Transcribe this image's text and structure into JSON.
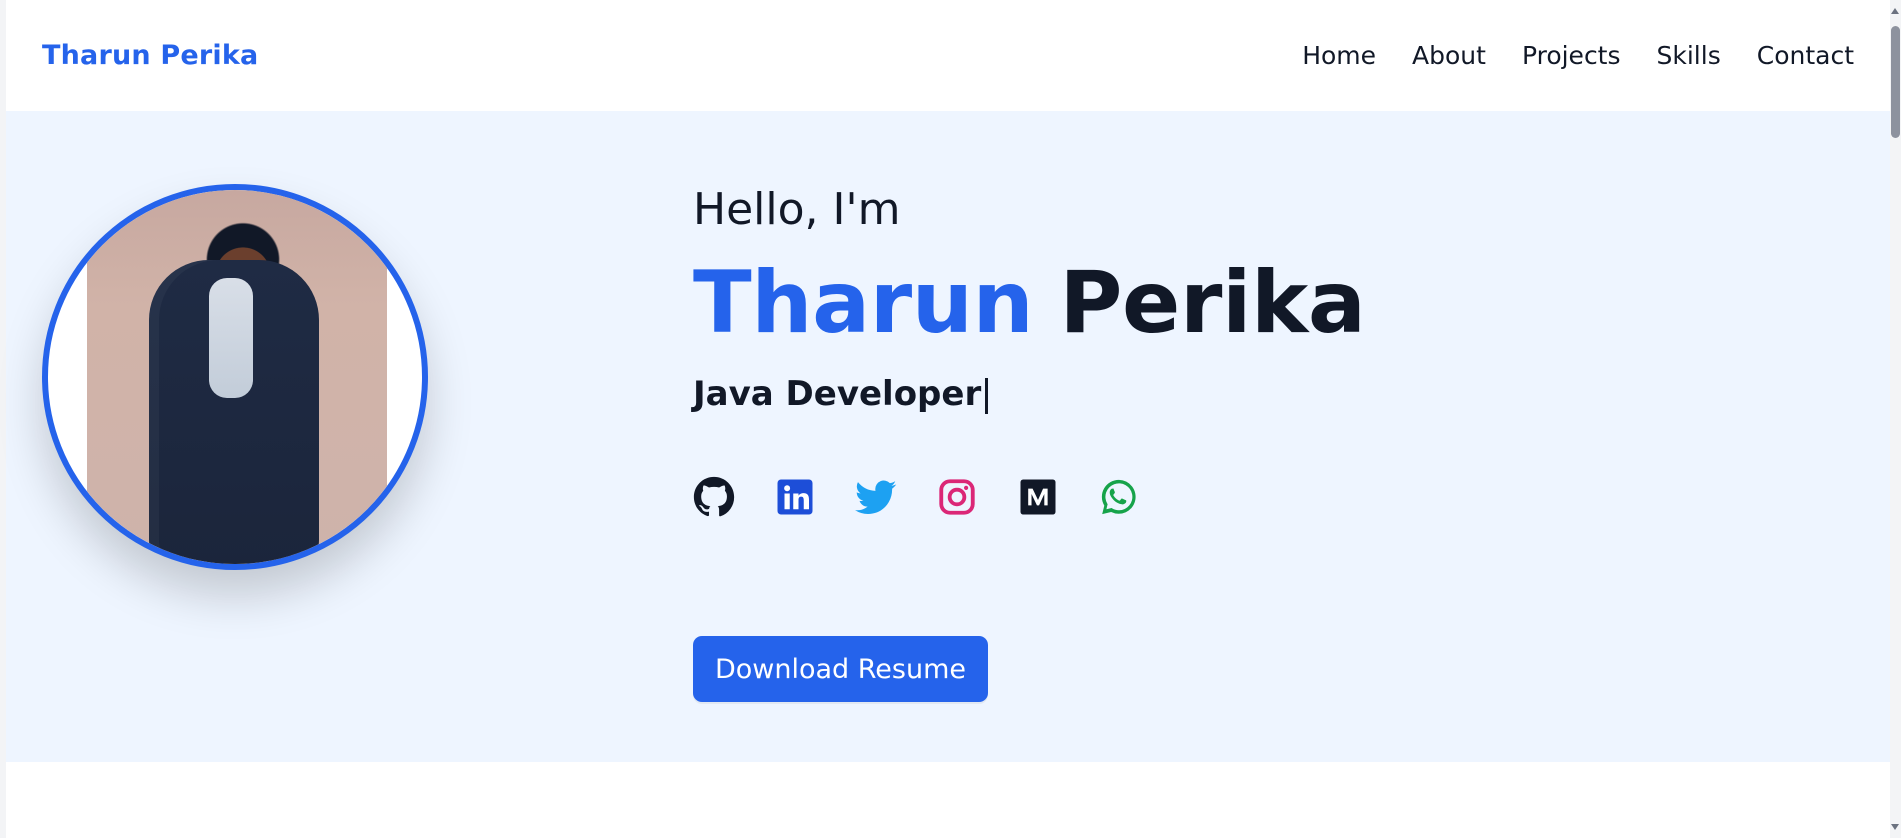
{
  "header": {
    "brand": "Tharun Perika",
    "nav": [
      "Home",
      "About",
      "Projects",
      "Skills",
      "Contact"
    ]
  },
  "hero": {
    "greeting": "Hello, I'm",
    "name_first": "Tharun",
    "name_last": "Perika",
    "role": "Java Developer",
    "cta": "Download Resume"
  },
  "social": [
    {
      "name": "github-icon"
    },
    {
      "name": "linkedin-icon"
    },
    {
      "name": "twitter-icon"
    },
    {
      "name": "instagram-icon"
    },
    {
      "name": "medium-icon"
    },
    {
      "name": "whatsapp-icon"
    }
  ],
  "colors": {
    "accent": "#2563eb",
    "hero_bg": "#eef5ff",
    "text": "#111827",
    "github": "#111827",
    "linkedin": "#1d4ed8",
    "twitter": "#1da1f2",
    "instagram": "#db2777",
    "medium": "#111827",
    "whatsapp": "#16a34a"
  }
}
